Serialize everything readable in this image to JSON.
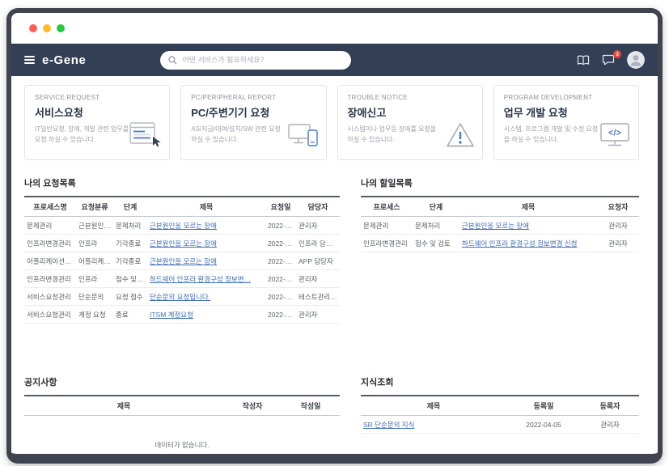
{
  "window": {
    "dot_colors": {
      "close": "#ff5f57",
      "minimize": "#febc2e",
      "zoom": "#2ac840"
    }
  },
  "header": {
    "logo": "e-Gene",
    "search_placeholder": "어떤 서비스가 필요하세요?",
    "chat_badge": "3",
    "bg_color": "#333f54"
  },
  "icons": {
    "menu": "hamburger",
    "search": "magnifier",
    "manual": "book",
    "notifications": "chat-bubble",
    "profile": "person-avatar",
    "cards": [
      "form-with-pointer",
      "monitor-and-phone",
      "warning-triangle",
      "monitor-with-code"
    ]
  },
  "colors": {
    "link": "#3e6db2",
    "accent": "#4a79c0"
  },
  "cards": [
    {
      "eyebrow": "SERVICE REQUEST",
      "title": "서비스요청",
      "desc": "IT일반요청, 장애, 개발 관련 업무를 요청 하실 수 있습니다."
    },
    {
      "eyebrow": "PC/PERIPHERAL REPORT",
      "title": "PC/주변기기 요청",
      "desc": "AS/지급/대여/설치/SW 관련 요청 하실 수 있습니다."
    },
    {
      "eyebrow": "TROUBLE NOTICE",
      "title": "장애신고",
      "desc": "시스템이나 업무등 장애를 요청을 하실 수 있습니다."
    },
    {
      "eyebrow": "PROGRAM DEVELOPMENT",
      "title": "업무 개발 요청",
      "desc": "시스템, 프로그램 개발 및 수정 요청을 하실 수 있습니다."
    }
  ],
  "my_requests": {
    "title": "나의 요청목록",
    "columns": [
      "프로세스명",
      "요청분류",
      "단계",
      "제목",
      "요청일",
      "담당자"
    ],
    "rows": [
      {
        "cells": [
          "문제관리",
          "근본원인…",
          "문제처리",
          "근본원인을 모르는 장애",
          "2022-0…",
          "관리자"
        ]
      },
      {
        "cells": [
          "인프라변경관리",
          "인프라",
          "기각종료",
          "근본원인을 모르는 장애",
          "2022-0…",
          "인프라 담당자"
        ]
      },
      {
        "cells": [
          "어플리케이션…",
          "어플리케…",
          "기각종료",
          "근본원인을 모르는 장애",
          "2022-0…",
          "APP 담당자"
        ]
      },
      {
        "cells": [
          "인프라변경관리",
          "인프라",
          "접수 및 …",
          "하드웨어 인프라 환경구성 정보변…",
          "2022-0…",
          "관리자"
        ]
      },
      {
        "cells": [
          "서비스요청관리",
          "단순문의",
          "요청 접수",
          "단순문의 요청입니다.",
          "2022-0…",
          "테스트관리자,APP 담당자…"
        ]
      },
      {
        "cells": [
          "서비스요청관리",
          "계정 요청",
          "종료",
          "ITSM 계정요청",
          "2022-0…",
          "관리자"
        ]
      }
    ]
  },
  "my_todos": {
    "title": "나의 할일목록",
    "columns": [
      "프로세스",
      "단계",
      "제목",
      "요청자"
    ],
    "rows": [
      {
        "cells": [
          "문제관리",
          "문제처리",
          "근본원인을 모르는 장애",
          "관리자"
        ]
      },
      {
        "cells": [
          "인프라변경관리",
          "접수 및 검토",
          "하드웨어 인프라 환경구성 정보변경 신청",
          "관리자"
        ]
      }
    ]
  },
  "notices": {
    "title": "공지사항",
    "columns": [
      "제목",
      "작성자",
      "작성일"
    ],
    "empty_text": "데이터가 없습니다."
  },
  "knowledge": {
    "title": "지식조회",
    "columns": [
      "제목",
      "등록일",
      "등록자"
    ],
    "rows": [
      {
        "cells": [
          "SR 단순문의 지식",
          "2022-04-05",
          "관리자"
        ]
      }
    ]
  }
}
